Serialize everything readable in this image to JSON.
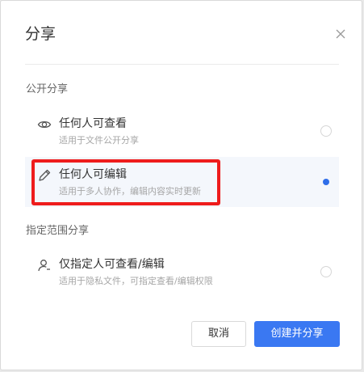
{
  "dialog": {
    "title": "分享",
    "close_icon": "close-icon"
  },
  "public_section": {
    "label": "公开分享",
    "options": [
      {
        "icon": "eye-icon",
        "title": "任何人可查看",
        "desc": "适用于文件公开分享",
        "selected": false
      },
      {
        "icon": "pencil-icon",
        "title": "任何人可编辑",
        "desc": "适用于多人协作，编辑内容实时更新",
        "selected": true
      }
    ]
  },
  "specified_section": {
    "label": "指定范围分享",
    "options": [
      {
        "icon": "user-icon",
        "title": "仅指定人可查看/编辑",
        "desc": "适用于隐私文件，可指定查看/编辑权限",
        "selected": false
      }
    ]
  },
  "buttons": {
    "cancel": "取消",
    "create": "创建并分享"
  },
  "colors": {
    "accent": "#3a78f2",
    "selected_bg": "#f4f7fc",
    "highlight": "#ee1c1c"
  }
}
